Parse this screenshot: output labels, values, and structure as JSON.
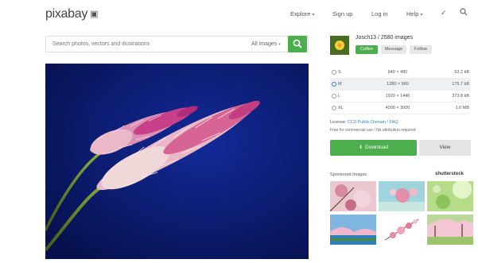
{
  "header": {
    "logo_text": "pixabay",
    "nav": {
      "explore": "Explore",
      "signup": "Sign up",
      "login": "Log in",
      "help": "Help"
    }
  },
  "search": {
    "placeholder": "Search photos, vectors and illustrations",
    "type": "All images"
  },
  "author": {
    "name": "Josch13 / 2580 images",
    "coffee": "Coffee",
    "message": "Message",
    "follow": "Follow"
  },
  "sizes": [
    {
      "label": "S",
      "dim": "640 × 480",
      "kb": "53.2 kB",
      "selected": false
    },
    {
      "label": "M",
      "dim": "1280 × 960",
      "kb": "175.7 kB",
      "selected": true
    },
    {
      "label": "L",
      "dim": "1920 × 1440",
      "kb": "373.8 kB",
      "selected": false
    },
    {
      "label": "XL",
      "dim": "4000 × 3000",
      "kb": "1.0 MB",
      "selected": false
    }
  ],
  "license": {
    "prefix": "License: ",
    "link": "CC0 Public Domain / FAQ",
    "note": "Free for commercial use / No attribution required"
  },
  "buttons": {
    "download": "Download",
    "view": "View"
  },
  "sponsored": {
    "label": "Sponsored Images",
    "brand": "shutterstock"
  },
  "colors": {
    "accent_green": "#4cae4c",
    "link_blue": "#3b7dd8",
    "image_bg": "#0b1c73"
  }
}
